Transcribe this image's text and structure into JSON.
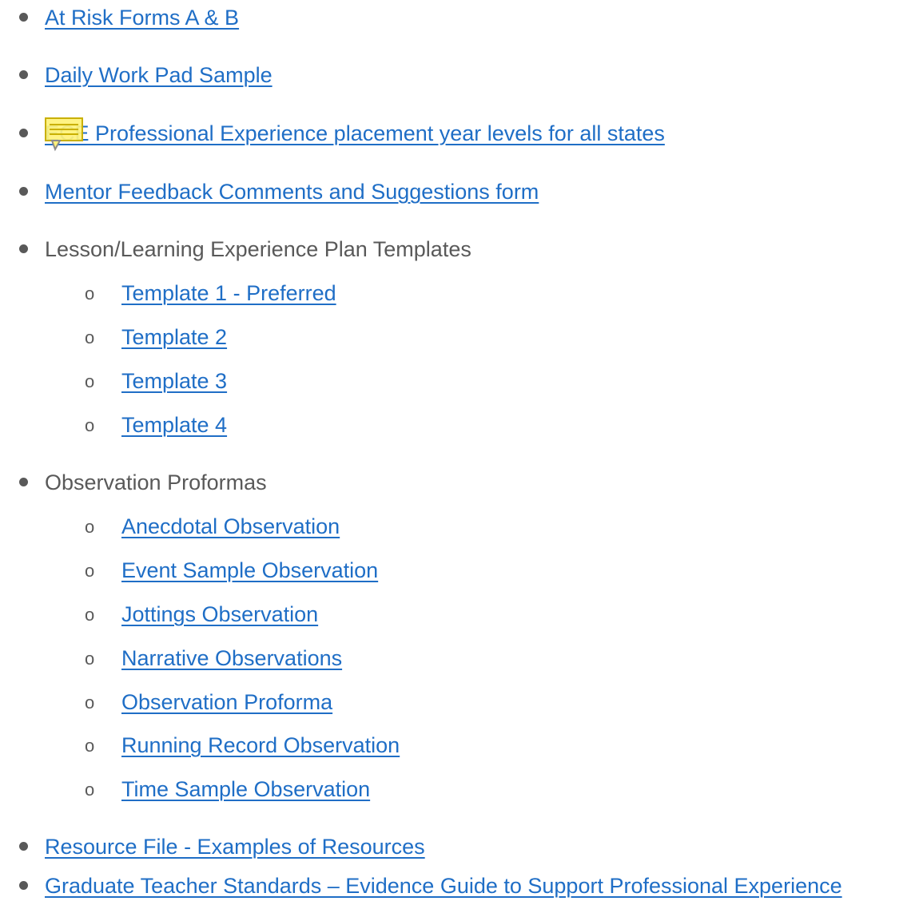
{
  "items": [
    {
      "level": 1,
      "text": "At Risk Forms A & B",
      "link": true
    },
    {
      "level": 1,
      "text": "Daily Work Pad Sample",
      "link": true
    },
    {
      "level": 1,
      "text": "ECE Professional Experience placement year levels for all states",
      "link": true
    },
    {
      "level": 1,
      "text": "Mentor Feedback Comments and Suggestions form",
      "link": true
    },
    {
      "level": 1,
      "text": "Lesson/Learning Experience Plan Templates",
      "link": false
    },
    {
      "level": 2,
      "text": "Template 1 - Preferred",
      "link": true
    },
    {
      "level": 2,
      "text": "Template 2",
      "link": true
    },
    {
      "level": 2,
      "text": "Template 3",
      "link": true
    },
    {
      "level": 2,
      "text": "Template 4",
      "link": true
    },
    {
      "level": 1,
      "text": "Observation Proformas",
      "link": false
    },
    {
      "level": 2,
      "text": "Anecdotal Observation",
      "link": true
    },
    {
      "level": 2,
      "text": "Event Sample Observation",
      "link": true
    },
    {
      "level": 2,
      "text": "Jottings Observation",
      "link": true
    },
    {
      "level": 2,
      "text": "Narrative Observations",
      "link": true
    },
    {
      "level": 2,
      "text": "Observation Proforma",
      "link": true
    },
    {
      "level": 2,
      "text": "Running Record Observation",
      "link": true
    },
    {
      "level": 2,
      "text": "Time Sample Observation",
      "link": true
    },
    {
      "level": 1,
      "text": "Resource File - Examples of Resources",
      "link": true
    },
    {
      "level": 1,
      "text": "Graduate Teacher Standards – Evidence Guide to Support Professional Experience",
      "link": true
    }
  ],
  "colors": {
    "link": "#1f6ec6",
    "text": "#595959",
    "comment_fill": "#fff27a",
    "comment_border": "#c9b000"
  },
  "bullets": {
    "level1": "•",
    "level2": "o"
  },
  "icons": {
    "comment": "comment-note-icon"
  }
}
